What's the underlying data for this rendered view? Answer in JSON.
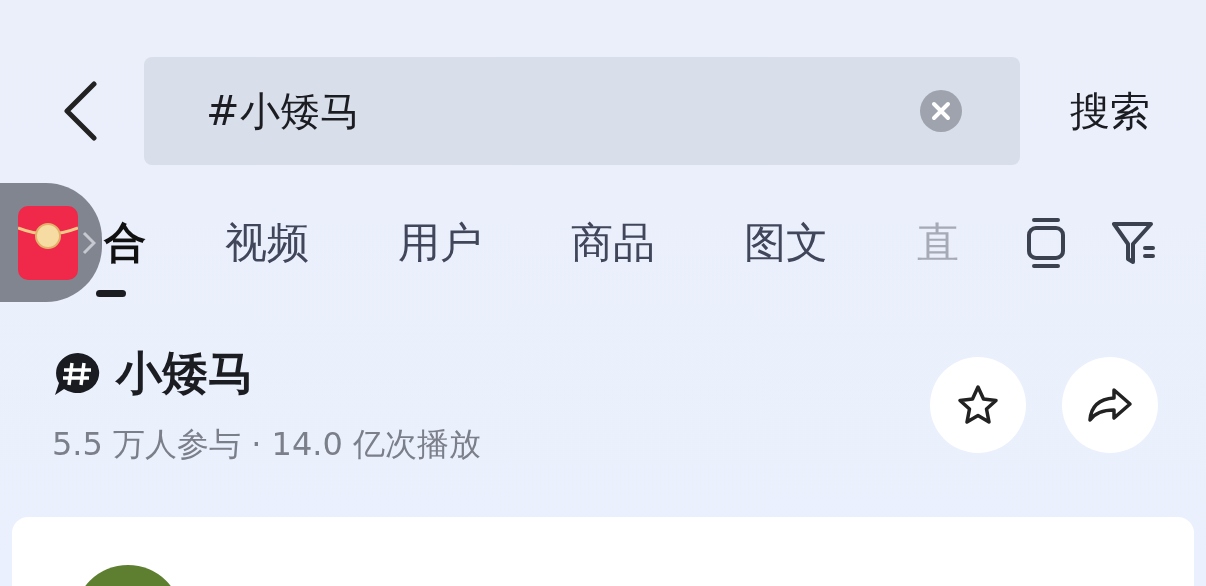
{
  "search_bar": {
    "value": "#小矮马",
    "submit_label": "搜索"
  },
  "tabs": [
    {
      "label": "合",
      "selected": true,
      "faded": false
    },
    {
      "label": "视频",
      "selected": false,
      "faded": false
    },
    {
      "label": "用户",
      "selected": false,
      "faded": false
    },
    {
      "label": "商品",
      "selected": false,
      "faded": false
    },
    {
      "label": "图文",
      "selected": false,
      "faded": false
    },
    {
      "label": "直",
      "selected": false,
      "faded": true
    }
  ],
  "topic": {
    "title": "小矮马",
    "stats": "5.5 万人参与 · 14.0 亿次播放"
  }
}
